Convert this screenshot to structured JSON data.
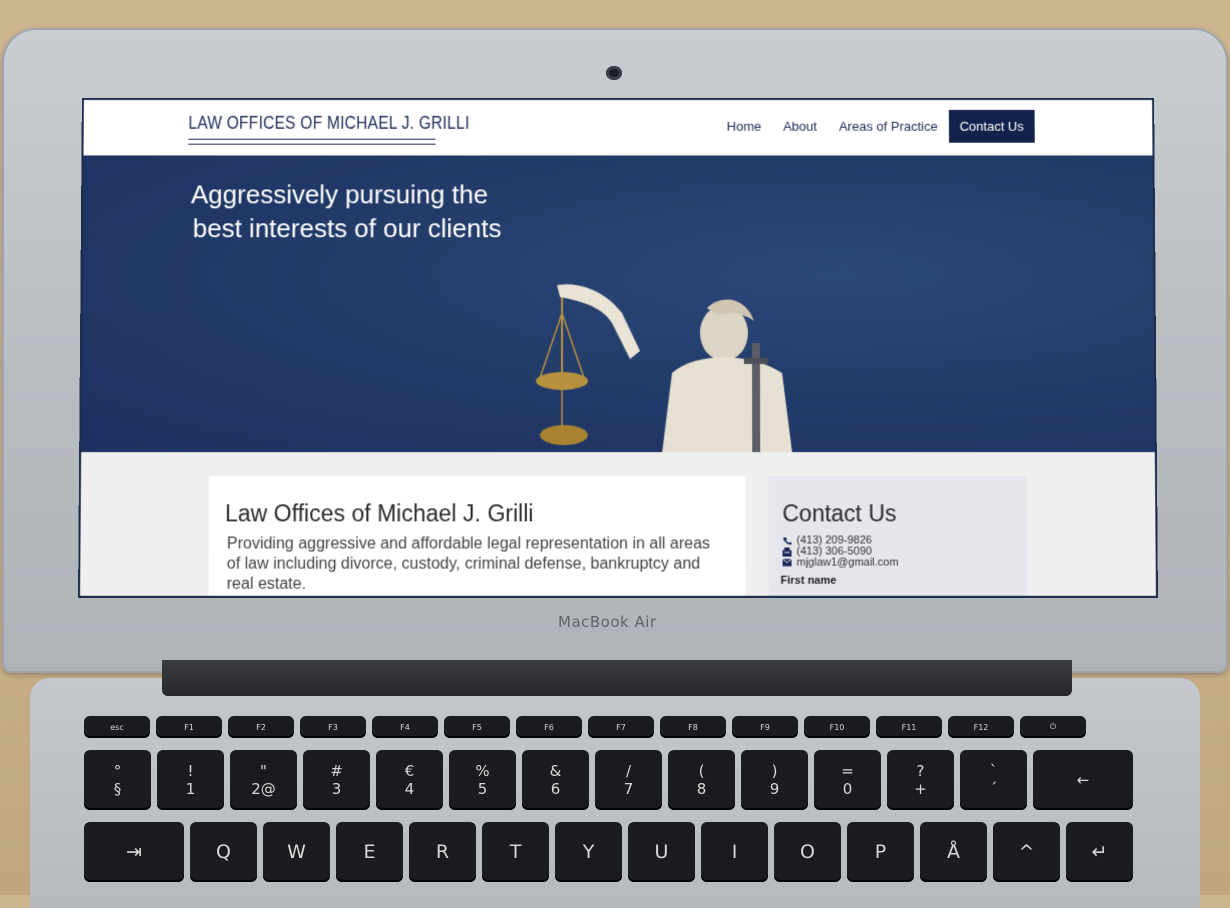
{
  "device": {
    "brand_label": "MacBook Air"
  },
  "site": {
    "logo_text": "LAW OFFICES OF MICHAEL J. GRILLI",
    "nav": [
      "Home",
      "About",
      "Areas of Practice",
      "Contact Us"
    ],
    "nav_active_index": 3,
    "hero": {
      "line1": "Aggressively pursuing the",
      "line2": "best interests of our clients"
    },
    "main_card": {
      "title": "Law Offices of Michael J. Grilli",
      "text": "Providing aggressive and affordable legal representation in all areas of law including divorce, custody, criminal defense, bankruptcy and real estate."
    },
    "contact_card": {
      "title": "Contact Us",
      "phone": "(413) 209-9826",
      "fax": "(413) 306-5090",
      "email": "mjglaw1@gmail.com",
      "first_name_label": "First name"
    }
  },
  "keyboard": {
    "fn_row": [
      "esc",
      "F1",
      "F2",
      "F3",
      "F4",
      "F5",
      "F6",
      "F7",
      "F8",
      "F9",
      "F10",
      "F11",
      "F12",
      "⏻"
    ],
    "number_row": [
      [
        "°",
        "§"
      ],
      [
        "!",
        "1"
      ],
      [
        "\"",
        "2@"
      ],
      [
        "#",
        "3"
      ],
      [
        "€",
        "4"
      ],
      [
        "%",
        "5"
      ],
      [
        "&",
        "6"
      ],
      [
        "/",
        "7"
      ],
      [
        "(",
        "8"
      ],
      [
        ")",
        "9"
      ],
      [
        "=",
        "0"
      ],
      [
        "?",
        "+"
      ],
      [
        "`",
        "´"
      ]
    ],
    "qwerty_row": [
      "⇥",
      "Q",
      "W",
      "E",
      "R",
      "T",
      "Y",
      "U",
      "I",
      "O",
      "P",
      "Å",
      "^"
    ]
  },
  "colors": {
    "brand_navy": "#13224c",
    "hero_blue": "#233c6a",
    "panel_gray": "#e4e6eb"
  }
}
